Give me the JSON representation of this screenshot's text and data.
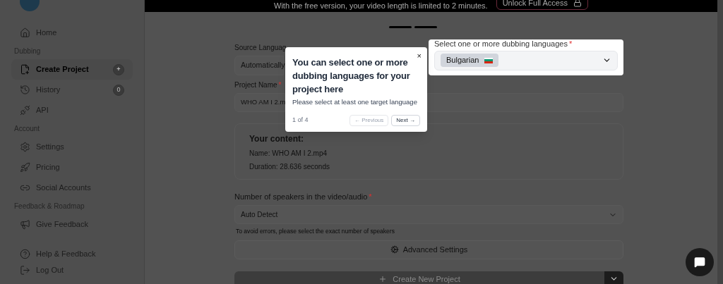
{
  "sidebar": {
    "sections": [
      {
        "items": [
          {
            "label": "Home",
            "selected": false
          }
        ]
      },
      {
        "heading": "Dubbing",
        "items": [
          {
            "label": "Create Project",
            "selected": true,
            "trailing": "+"
          },
          {
            "label": "History",
            "selected": false,
            "trailing": "0"
          },
          {
            "label": "API",
            "selected": false
          }
        ]
      },
      {
        "heading": "Account",
        "items": [
          {
            "label": "Settings",
            "selected": false
          },
          {
            "label": "Pricing",
            "selected": false
          },
          {
            "label": "Social Accounts",
            "selected": false
          }
        ]
      },
      {
        "heading": "Feedback & Roadmap",
        "items": [
          {
            "label": "Give Feedback",
            "selected": false
          }
        ]
      }
    ],
    "footer": [
      {
        "label": "Help & Feedback"
      },
      {
        "label": "Log Out"
      }
    ]
  },
  "banner": {
    "text": "With the free version, your video length is limited to 2 minutes.",
    "button": "Unlock Full Access"
  },
  "steps": [
    {
      "selected": true
    },
    {
      "selected": true
    }
  ],
  "form": {
    "source_language": {
      "label": "Source Languag",
      "value": "Automatically"
    },
    "target_languages": {
      "label": "Select one or more dubbing languages",
      "required_mark": "*",
      "chips": [
        {
          "label": "Bulgarian"
        }
      ]
    },
    "project_name": {
      "label": "Project Name",
      "required_mark": "*",
      "value": "WHO AM I 2.m"
    },
    "content": {
      "title": "Your content:",
      "lines": [
        "Name: WHO AM I 2.mp4",
        "Duration: 28.636 seconds"
      ]
    },
    "speakers": {
      "label": "Number of speakers in the video/audio",
      "required_mark": "*",
      "value": "Auto Detect",
      "hint": "To avoid errors, please select the exact number of speakers"
    },
    "advanced_button": "Advanced Settings",
    "create_button": "Create New Project"
  },
  "tour": {
    "title": "You can select one or more dubbing languages for your project here",
    "description": "Please select at least one target language",
    "close": "×",
    "progress": "1 of 4",
    "previous": {
      "label": "← Previous",
      "disabled": true
    },
    "next": {
      "label": "Next →",
      "disabled": false
    }
  }
}
